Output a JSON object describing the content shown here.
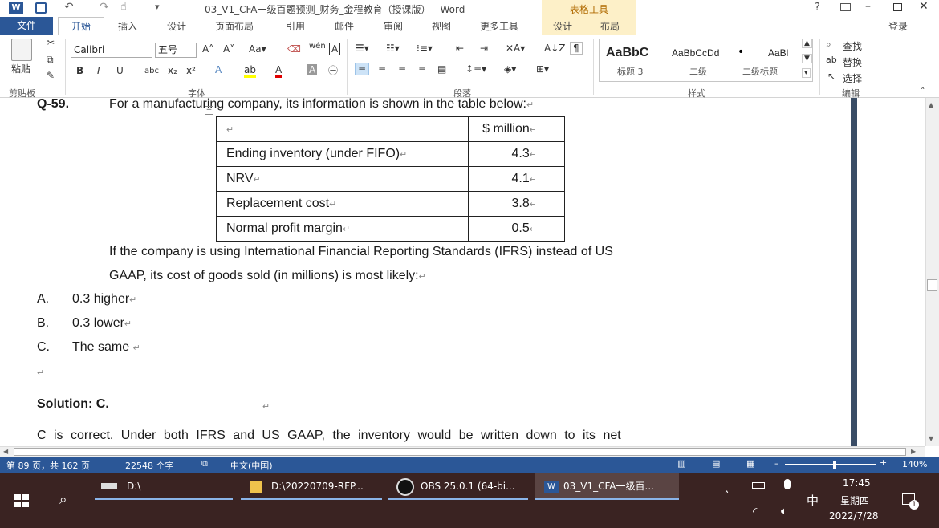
{
  "window": {
    "title": "03_V1_CFA一级百题预测_财务_金程教育（授课版） - Word",
    "context_tools": "表格工具",
    "help": "?",
    "signin": "登录"
  },
  "tabs": {
    "file": "文件",
    "home": "开始",
    "insert": "插入",
    "design": "设计",
    "layout": "页面布局",
    "references": "引用",
    "mailings": "邮件",
    "review": "审阅",
    "view": "视图",
    "more": "更多工具",
    "table_design": "设计",
    "table_layout": "布局"
  },
  "ribbon": {
    "paste": "粘贴",
    "clipboard": "剪贴板",
    "font_group": "字体",
    "paragraph_group": "段落",
    "styles_group": "样式",
    "editing_group": "编辑",
    "font_name": "Calibri",
    "font_size": "五号",
    "styles": [
      {
        "preview": "AaBbC",
        "name": "标题 3"
      },
      {
        "preview": "AaBbCcDd",
        "name": "二级"
      },
      {
        "preview": "AaBl",
        "name": "二级标题"
      }
    ],
    "find": "查找",
    "replace": "替换",
    "select": "选择"
  },
  "doc": {
    "q_num": "Q-59.",
    "q_intro": "For a manufacturing company, its information is shown in the table below:",
    "table": {
      "header": "$ million",
      "rows": [
        {
          "label": "Ending inventory (under FIFO)",
          "value": "4.3"
        },
        {
          "label": "NRV",
          "value": "4.1"
        },
        {
          "label": "Replacement cost",
          "value": "3.8"
        },
        {
          "label": "Normal profit margin",
          "value": "0.5"
        }
      ]
    },
    "q_line1": "If the company is using International Financial Reporting Standards (IFRS) instead of US",
    "q_line2": "GAAP, its cost of goods sold (in millions) is most likely:",
    "options": [
      {
        "letter": "A.",
        "text": "0.3 higher"
      },
      {
        "letter": "B.",
        "text": "0.3 lower"
      },
      {
        "letter": "C.",
        "text": "The same"
      }
    ],
    "solution": "Solution: C.",
    "explanation": "C is correct. Under both IFRS and US GAAP, the inventory would be written down to its net",
    "para_mark": "↵"
  },
  "status": {
    "page": "第 89 页，共 162 页",
    "words": "22548 个字",
    "language": "中文(中国)",
    "zoom": "140%"
  },
  "taskbar": {
    "items": [
      "D:\\",
      "D:\\20220709-RFP...",
      "OBS 25.0.1 (64-bi...",
      "03_V1_CFA一级百..."
    ],
    "ime": "中",
    "time": "17:45",
    "weekday": "星期四",
    "date": "2022/7/28",
    "notif_count": "1"
  }
}
